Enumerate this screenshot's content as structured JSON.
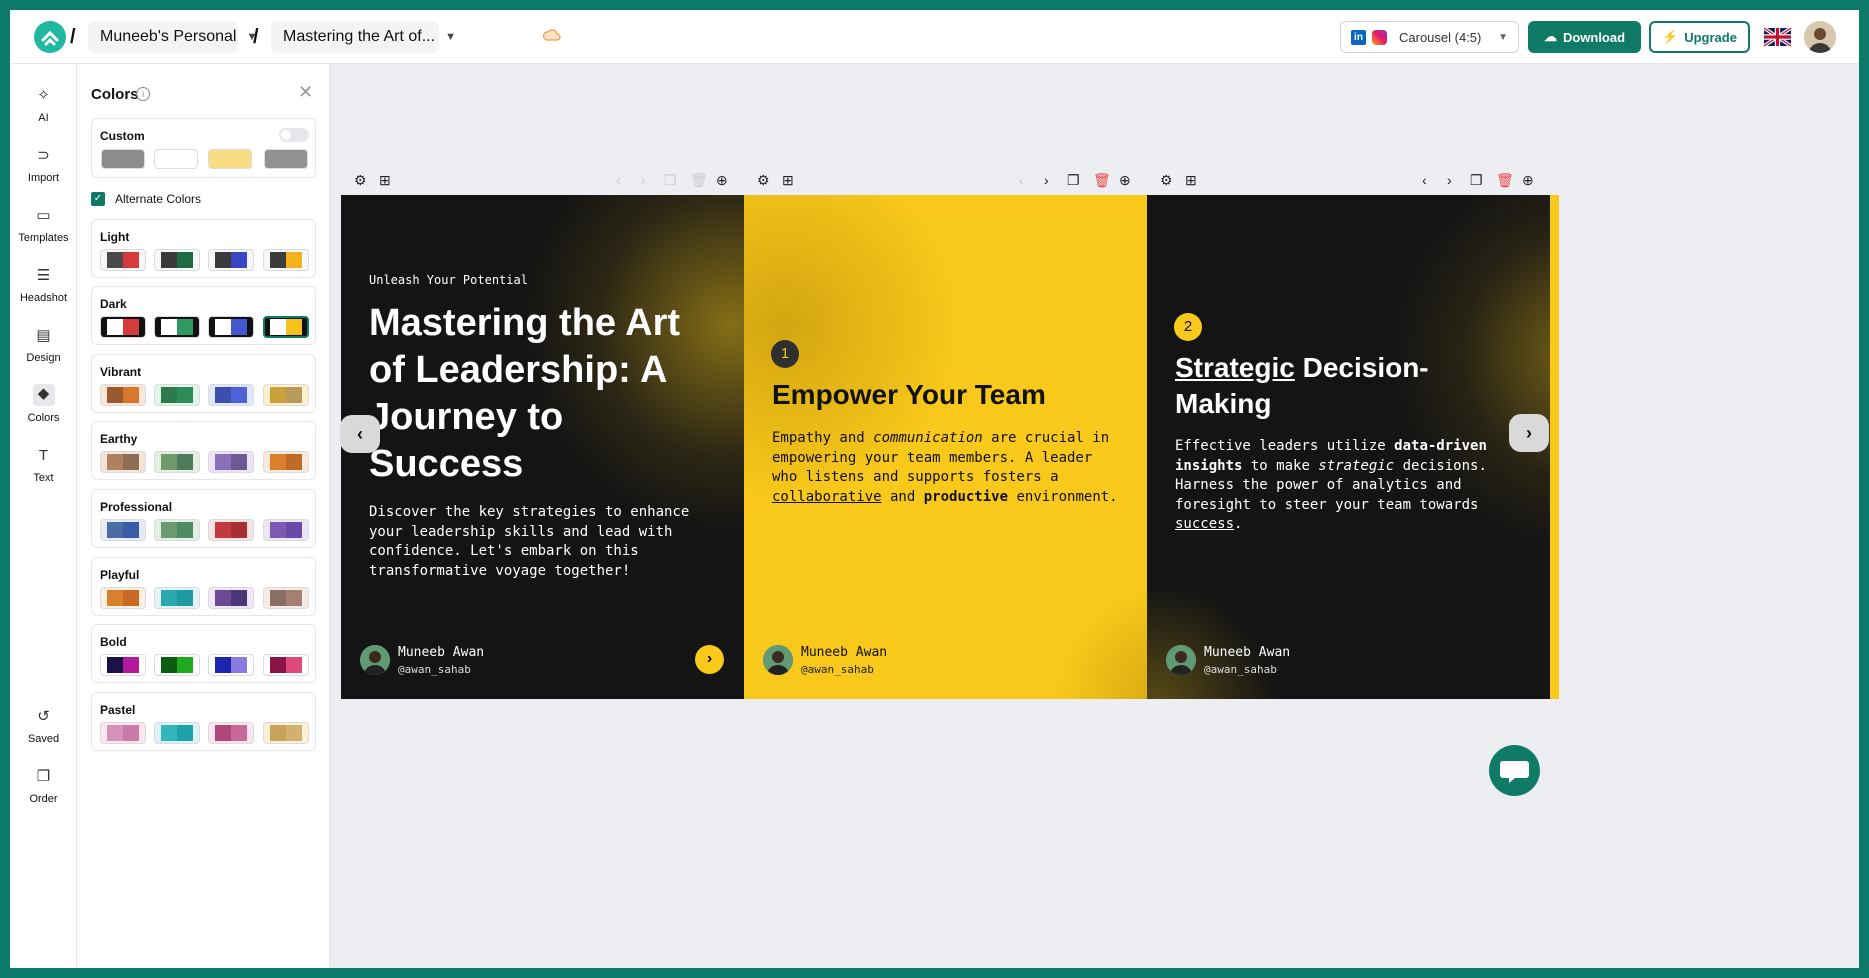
{
  "topbar": {
    "workspace": "Muneeb's Personal",
    "document": "Mastering the Art of...",
    "format": "Carousel (4:5)",
    "download": "Download",
    "upgrade": "Upgrade",
    "separator": "/"
  },
  "rail": {
    "items": [
      {
        "label": "AI",
        "icon": "sparkle-icon"
      },
      {
        "label": "Import",
        "icon": "import-icon"
      },
      {
        "label": "Templates",
        "icon": "templates-icon"
      },
      {
        "label": "Headshot",
        "icon": "headshot-icon"
      },
      {
        "label": "Design",
        "icon": "design-icon"
      },
      {
        "label": "Colors",
        "icon": "colors-icon"
      },
      {
        "label": "Text",
        "icon": "text-icon"
      },
      {
        "label": "Saved",
        "icon": "history-icon"
      },
      {
        "label": "Order",
        "icon": "order-icon"
      }
    ]
  },
  "panel": {
    "title": "Colors",
    "custom_label": "Custom",
    "custom_colors": [
      "#8c8c8c",
      "#ffffff",
      "#f9dd85",
      "#919191"
    ],
    "alternate_label": "Alternate Colors",
    "groups": [
      {
        "name": "Light",
        "swatches": [
          [
            "#f7f7f7",
            "#4a4a4a",
            "#d63a3a"
          ],
          [
            "#f7f7f7",
            "#3b3b3b",
            "#1f6b43"
          ],
          [
            "#f7f7f7",
            "#3b3b3b",
            "#3b46c4"
          ],
          [
            "#f7f7f7",
            "#3b3b3b",
            "#f2b21a"
          ]
        ]
      },
      {
        "name": "Dark",
        "swatches": [
          [
            "#111111",
            "#ffffff",
            "#d63a3a"
          ],
          [
            "#111111",
            "#ffffff",
            "#2e9a62"
          ],
          [
            "#111111",
            "#ffffff",
            "#4457cf"
          ],
          [
            "#111111",
            "#ffffff",
            "#f4c21a"
          ]
        ]
      },
      {
        "name": "Vibrant",
        "swatches": [
          [
            "#fbe6d7",
            "#9a5a2f",
            "#d9772e"
          ],
          [
            "#e3f4e9",
            "#2f7a4b",
            "#2e8c58"
          ],
          [
            "#e1e7fb",
            "#3c4fae",
            "#4d63d6"
          ],
          [
            "#fbf1cc",
            "#c8a13a",
            "#b89a5c"
          ]
        ]
      },
      {
        "name": "Earthy",
        "swatches": [
          [
            "#f4e3d6",
            "#b08060",
            "#8c6e52"
          ],
          [
            "#e4efe0",
            "#6f9a6e",
            "#4d7b5c"
          ],
          [
            "#ece3f5",
            "#8a70b8",
            "#6b5a94"
          ],
          [
            "#faeadb",
            "#d8802c",
            "#c06a27"
          ]
        ]
      },
      {
        "name": "Professional",
        "swatches": [
          [
            "#e4ebf5",
            "#4b6ba3",
            "#3a5ca8"
          ],
          [
            "#e3efe5",
            "#6b9a70",
            "#4f8a63"
          ],
          [
            "#f5e3e5",
            "#c2393e",
            "#a82f33"
          ],
          [
            "#ece5f5",
            "#7a5ab3",
            "#6a4aa8"
          ]
        ]
      },
      {
        "name": "Playful",
        "swatches": [
          [
            "#fcefe3",
            "#d8802c",
            "#c86a22"
          ],
          [
            "#e2f4f5",
            "#2aa8b0",
            "#1e9aa3"
          ],
          [
            "#f0e8f8",
            "#6a4a94",
            "#4e3778"
          ],
          [
            "#f5ece8",
            "#8a6e62",
            "#a58072"
          ]
        ]
      },
      {
        "name": "Bold",
        "swatches": [
          [
            "#ffffff",
            "#1b1247",
            "#b31a9a"
          ],
          [
            "#ffffff",
            "#0b5c11",
            "#1faa1f"
          ],
          [
            "#ffffff",
            "#1c24b0",
            "#8a7ae0"
          ],
          [
            "#ffffff",
            "#8a1448",
            "#e04a7a"
          ]
        ]
      },
      {
        "name": "Pastel",
        "swatches": [
          [
            "#fde7ef",
            "#d693b8",
            "#c87aa8"
          ],
          [
            "#dcf2f4",
            "#32b6be",
            "#1fa3ab"
          ],
          [
            "#fbe6ef",
            "#b0477a",
            "#c86a98"
          ],
          [
            "#fbf1d5",
            "#c8a15a",
            "#d4b070"
          ]
        ]
      }
    ]
  },
  "slides": [
    {
      "kicker": "Unleash Your Potential",
      "title": "Mastering the Art of Leadership: A Journey to Success",
      "body": "Discover the key strategies to enhance your leadership skills and lead with confidence. Let's embark on this transformative voyage together!",
      "author": "Muneeb Awan",
      "handle": "@awan_sahab"
    },
    {
      "number": "1",
      "title": "Empower Your Team",
      "body_parts": [
        "Empathy and ",
        "communication",
        " are crucial in empowering your team members. A leader who listens and supports fosters a ",
        "collaborative",
        " and ",
        "productive",
        " environment."
      ],
      "author": "Muneeb Awan",
      "handle": "@awan_sahab"
    },
    {
      "number": "2",
      "title_underlined": "Strategic",
      "title_rest": " Decision-Making",
      "body_parts": [
        "Effective leaders utilize ",
        "data-driven insights",
        " to make ",
        "strategic",
        " decisions. Harness the power of analytics and foresight to steer your team towards ",
        "success",
        "."
      ],
      "author": "Muneeb Awan",
      "handle": "@awan_sahab"
    }
  ],
  "colors": {
    "brand": "#0f7a66",
    "accent_yellow": "#f8c81a",
    "slide_dark": "#141414",
    "frame": "#0b7a68"
  }
}
